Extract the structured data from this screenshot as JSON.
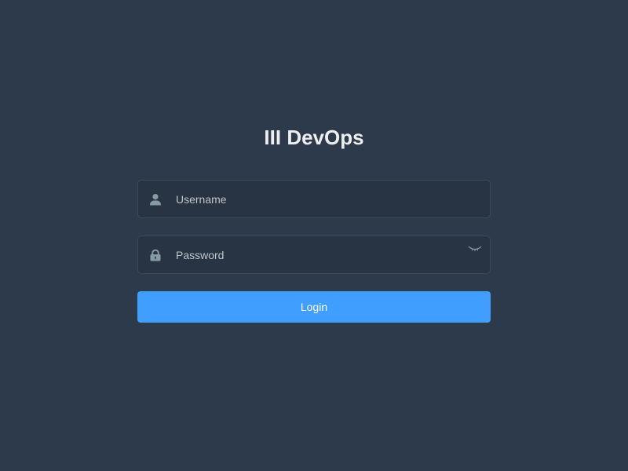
{
  "login": {
    "title": "III DevOps",
    "username": {
      "value": "",
      "placeholder": "Username",
      "icon": "user-icon"
    },
    "password": {
      "value": "",
      "placeholder": "Password",
      "icon": "lock-icon",
      "toggle_icon": "eye-closed-icon"
    },
    "button_label": "Login"
  },
  "colors": {
    "background": "#2d3a4b",
    "input_background": "#283443",
    "input_border": "#3e4a59",
    "button": "#409eff",
    "title": "#eeeeee",
    "icon": "#889aa4"
  }
}
